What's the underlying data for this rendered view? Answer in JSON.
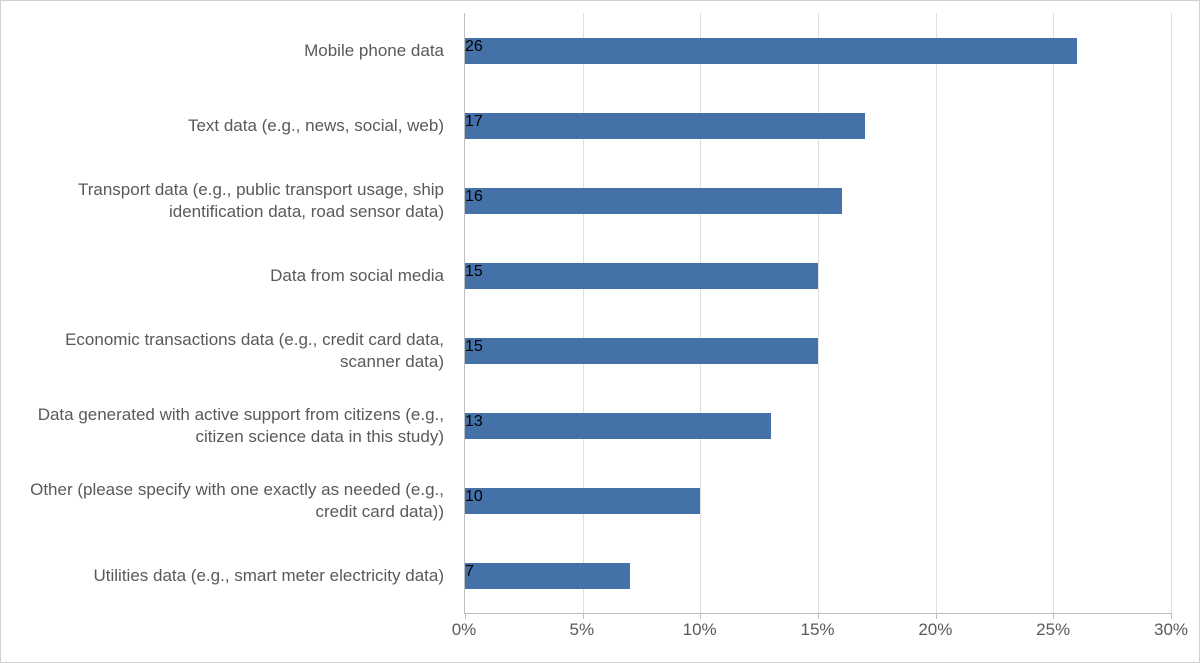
{
  "chart_data": {
    "type": "bar",
    "orientation": "horizontal",
    "categories": [
      "Mobile phone data",
      "Text data (e.g., news, social, web)",
      "Transport data (e.g., public transport usage, ship identification data, road sensor data)",
      "Data from social media",
      "Economic transactions data (e.g., credit card data, scanner data)",
      "Data generated with active support from citizens (e.g., citizen science data in this study)",
      "Other (please specify with one exactly as needed (e.g., credit card data))",
      "Utilities data (e.g., smart meter electricity data)"
    ],
    "values": [
      26,
      17,
      16,
      15,
      15,
      13,
      10,
      7
    ],
    "xlim": [
      0,
      30
    ],
    "x_ticks": [
      0,
      5,
      10,
      15,
      20,
      25,
      30
    ],
    "x_tick_labels": [
      "0%",
      "5%",
      "10%",
      "15%",
      "20%",
      "25%",
      "30%"
    ],
    "title": "",
    "xlabel": "",
    "ylabel": "",
    "bar_color": "#4472a8"
  }
}
